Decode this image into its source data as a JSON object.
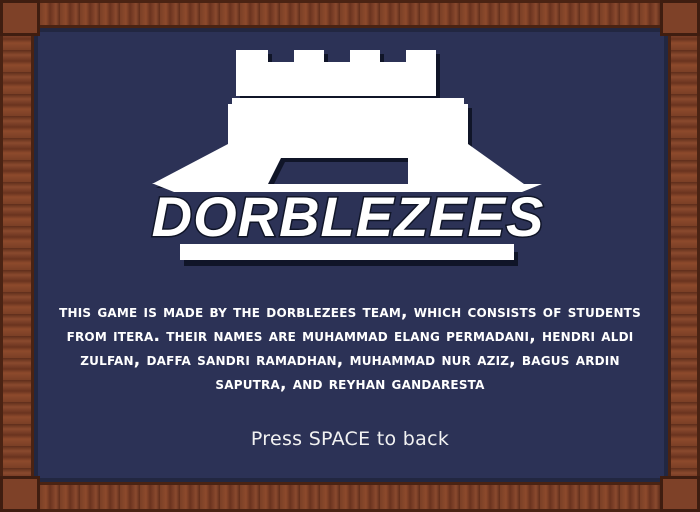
{
  "logo": {
    "title": "DORBLEZEES",
    "icon": "castle-icon"
  },
  "about": {
    "text": "This game is made by the Dorblezees team, which consists of students from ITERA. Their names are Muhammad Elang Permadani, Hendri Aldi Zulfan, Daffa Sandri Ramadhan, Muhammad Nur Aziz, Bagus Ardin Saputra, and Reyhan Gandaresta"
  },
  "hint": {
    "text": "Press SPACE to back"
  },
  "colors": {
    "background": "#2c3256",
    "frame": "#7a3f26",
    "text": "#ffffff"
  }
}
